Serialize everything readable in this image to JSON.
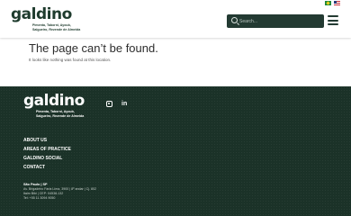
{
  "header": {
    "logo": {
      "word": "galdino",
      "tagline": [
        "Pimenta, Taborni, Ayoub,",
        "Salgueiro, Rezende de Almeida"
      ]
    },
    "flags": [
      "brazil-flag",
      "usa-flag"
    ],
    "search": {
      "placeholder": "Search..."
    },
    "menu_icon": "hamburger-menu-icon"
  },
  "main": {
    "title": "The page can’t be found.",
    "subtitle": "It looks like nothing was found at this location."
  },
  "footer": {
    "logo": {
      "word": "galdino",
      "tagline": [
        "Pimenta, Taborni, Ayoub,",
        "Salgueiro, Rezende de Almeida"
      ]
    },
    "social": [
      "instagram-icon",
      "linkedin-icon"
    ],
    "nav": [
      "ABOUT US",
      "AREAS OF PRACTICE",
      "GALDINO SOCIAL",
      "CONTACT"
    ],
    "address": {
      "title": "São Paulo | SP",
      "lines": [
        "Av. Brigadeiro Faria Lima, 3900 | 8º andar | Cj. 802",
        "Itaim Bibi | CEP: 04538-132",
        "Tel: +55 11 3094 9050"
      ]
    }
  },
  "colors": {
    "brand_dark_green": "#1b3228",
    "search_bg": "#233a32",
    "text_dark": "#2c2c2c"
  }
}
